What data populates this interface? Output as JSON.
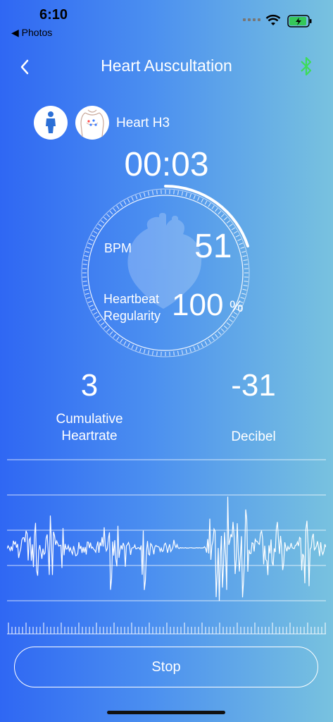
{
  "status_bar": {
    "time": "6:10",
    "back_app": "◀ Photos"
  },
  "nav": {
    "title": "Heart Auscultation"
  },
  "patient": {
    "position_label": "Heart H3"
  },
  "timer": "00:03",
  "dial": {
    "progress_fraction": 0.2,
    "bpm_label": "BPM",
    "bpm_value": "51",
    "regularity_label_1": "Heartbeat",
    "regularity_label_2": "Regularity",
    "regularity_value": "100",
    "regularity_unit": "%"
  },
  "stats": {
    "cumulative_value": "3",
    "cumulative_label_1": "Cumulative",
    "cumulative_label_2": "Heartrate",
    "decibel_value": "-31",
    "decibel_label": "Decibel"
  },
  "stop_label": "Stop",
  "colors": {
    "bluetooth": "#3ddc5a",
    "bg_left": "#2f67f3",
    "bg_right": "#78c2df"
  },
  "icons": [
    "back-chevron-icon",
    "bluetooth-icon",
    "person-icon",
    "chest-body-icon",
    "wifi-icon",
    "battery-icon",
    "heart-icon"
  ]
}
